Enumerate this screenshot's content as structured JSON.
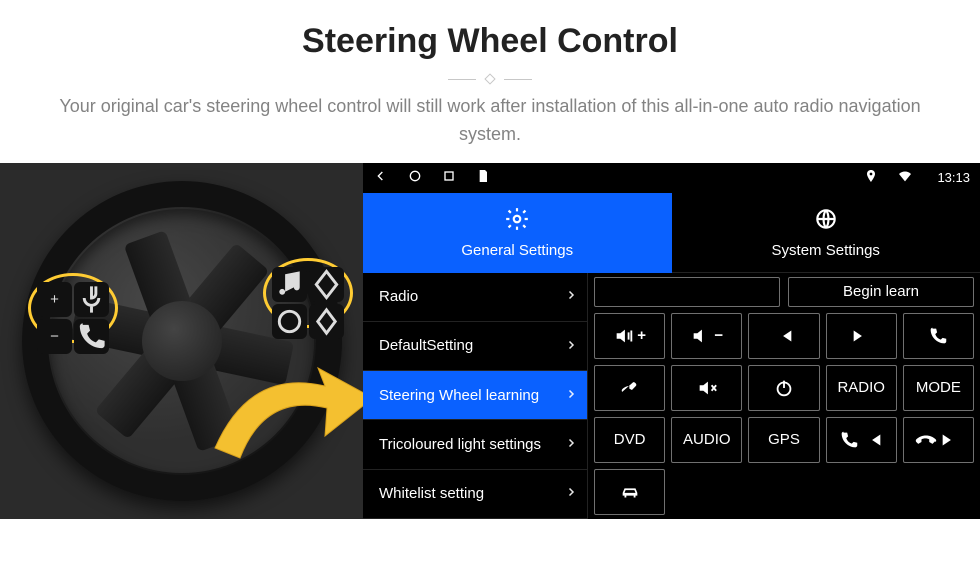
{
  "hero": {
    "title": "Steering Wheel Control",
    "description": "Your original car's steering wheel control will still work after installation of this all-in-one auto radio navigation system."
  },
  "wheel": {
    "left_buttons": [
      "plus",
      "voice",
      "minus",
      "phone"
    ],
    "right_buttons": [
      "music",
      "diamond",
      "circle",
      "diamond-open"
    ]
  },
  "status_bar": {
    "clock": "13:13"
  },
  "tabs": {
    "general": "General Settings",
    "system": "System Settings",
    "active": "general"
  },
  "side_menu": [
    {
      "label": "Radio",
      "active": false
    },
    {
      "label": "DefaultSetting",
      "active": false
    },
    {
      "label": "Steering Wheel learning",
      "active": true
    },
    {
      "label": "Tricoloured light settings",
      "active": false
    },
    {
      "label": "Whitelist setting",
      "active": false
    }
  ],
  "top_row": {
    "empty": "",
    "begin": "Begin learn"
  },
  "grid": {
    "radio": "RADIO",
    "mode": "MODE",
    "dvd": "DVD",
    "audio": "AUDIO",
    "gps": "GPS"
  }
}
